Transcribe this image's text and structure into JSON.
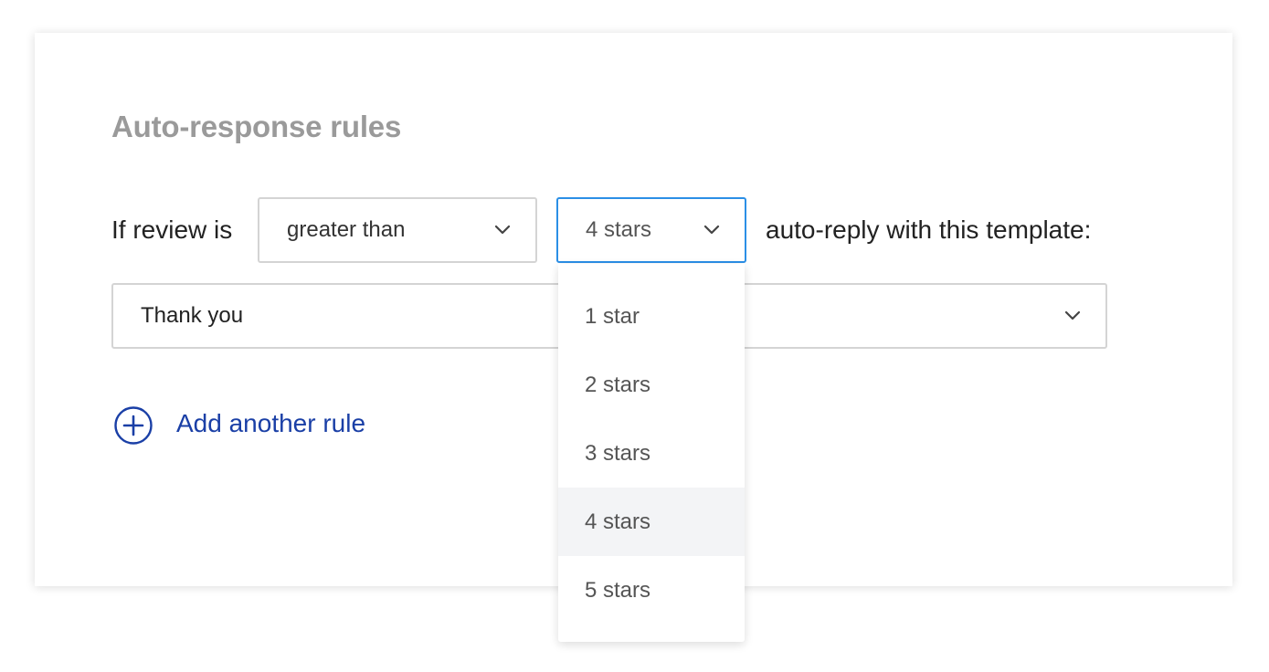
{
  "section": {
    "title": "Auto-response rules"
  },
  "rule": {
    "prefix_label": "If review is",
    "operator_value": "greater than",
    "stars_value": "4 stars",
    "suffix_label": "auto-reply with this template:",
    "template_value": "Thank you"
  },
  "stars_dropdown": {
    "options": [
      "1 star",
      "2 stars",
      "3 stars",
      "4 stars",
      "5 stars"
    ],
    "selected": "4 stars"
  },
  "add_rule": {
    "label": "Add another rule"
  },
  "colors": {
    "accent": "#1a3fa6",
    "focus_border": "#2b8fe6",
    "title_gray": "#9a9a9a",
    "selected_option_bg": "#f3f4f6"
  },
  "icons": {
    "chevron": "chevron-down-icon",
    "add": "plus-circle-icon"
  }
}
